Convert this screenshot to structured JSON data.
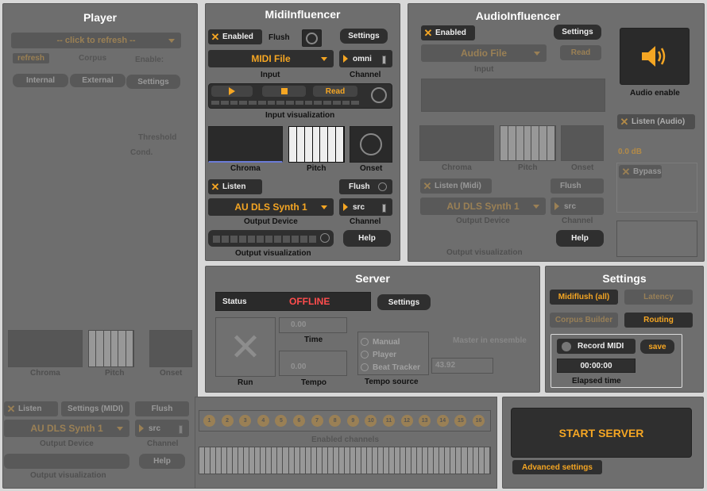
{
  "player": {
    "title": "Player",
    "refresh": "-- click to refresh --",
    "tab_refresh": "refresh",
    "tab_corpus": "Corpus",
    "enable": "Enable:",
    "internal": "Internal",
    "external": "External",
    "settings": "Settings",
    "threshold": "Threshold",
    "cond": "Cond.",
    "listen": "Listen",
    "settings_midi": "Settings (MIDI)",
    "flush": "Flush",
    "output_device": "AU DLS Synth 1",
    "output_device_label": "Output Device",
    "src": "src",
    "channel_label": "Channel",
    "help": "Help",
    "output_vis_label": "Output visualization",
    "chroma": "Chroma",
    "pitch": "Pitch",
    "onset": "Onset"
  },
  "midi": {
    "title": "MidiInfluencer",
    "enabled": "Enabled",
    "flush": "Flush",
    "settings": "Settings",
    "input_value": "MIDI File",
    "input_label": "Input",
    "channel_value": "omni",
    "channel_label": "Channel",
    "read": "Read",
    "input_vis_label": "Input visualization",
    "chroma": "Chroma",
    "pitch": "Pitch",
    "onset": "Onset",
    "listen": "Listen",
    "flush2": "Flush",
    "output_device": "AU DLS Synth 1",
    "output_device_label": "Output Device",
    "src": "src",
    "channel2_label": "Channel",
    "output_vis_label": "Output visualization",
    "help": "Help"
  },
  "audio": {
    "title": "AudioInfluencer",
    "enabled": "Enabled",
    "settings": "Settings",
    "input_value": "Audio File",
    "read": "Read",
    "input_label": "Input",
    "audio_enable": "Audio enable",
    "listen_audio": "Listen (Audio)",
    "db": "0.0 dB",
    "bypass": "Bypass",
    "chroma": "Chroma",
    "pitch": "Pitch",
    "onset": "Onset",
    "listen_midi": "Listen (Midi)",
    "flush": "Flush",
    "output_device": "AU DLS Synth 1",
    "output_device_label": "Output Device",
    "src": "src",
    "channel_label": "Channel",
    "help": "Help",
    "output_vis_label": "Output visualization"
  },
  "server": {
    "title": "Server",
    "status_label": "Status",
    "status_value": "OFFLINE",
    "settings": "Settings",
    "time_value": "0.00",
    "time_label": "Time",
    "tempo_value": "0.00",
    "tempo_label": "Tempo",
    "run_label": "Run",
    "tempo_options": [
      "Manual",
      "Player",
      "Beat Tracker"
    ],
    "tempo_source_label": "Tempo source",
    "master_label": "Master in ensemble",
    "tempo_num": "43.92"
  },
  "settings": {
    "title": "Settings",
    "midiflush": "Midiflush (all)",
    "latency": "Latency",
    "corpus_builder": "Corpus Builder",
    "routing": "Routing",
    "record_midi": "Record MIDI",
    "save": "save",
    "elapsed_value": "00:00:00",
    "elapsed_label": "Elapsed time"
  },
  "channels": {
    "label": "Enabled channels",
    "items": [
      "1",
      "2",
      "3",
      "4",
      "5",
      "6",
      "7",
      "8",
      "9",
      "10",
      "11",
      "12",
      "13",
      "14",
      "15",
      "16"
    ]
  },
  "start": {
    "start_server": "START SERVER",
    "advanced": "Advanced settings"
  },
  "colors": {
    "accent": "#f5a623",
    "offline": "#ff4d4d",
    "panel": "#6e6e6e",
    "control": "#2f2f2f"
  }
}
